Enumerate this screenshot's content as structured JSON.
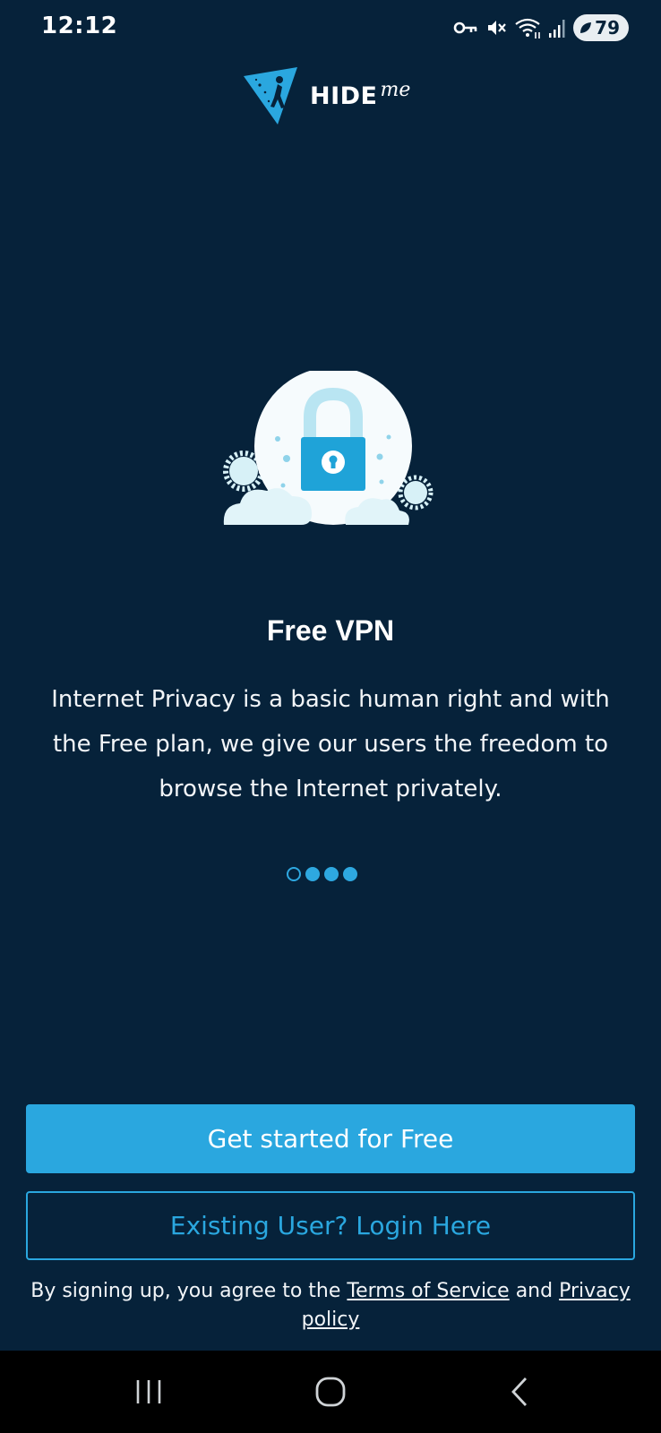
{
  "status_bar": {
    "time": "12:12",
    "battery_level": "79",
    "icons": [
      "vpn-key-icon",
      "mute-icon",
      "wifi-icon",
      "signal-icon",
      "battery-saver-icon"
    ]
  },
  "logo": {
    "brand_main": "HIDE",
    "brand_suffix": "me"
  },
  "onboarding": {
    "illustration": "padlock-cloud-illustration",
    "title": "Free VPN",
    "description": "Internet Privacy is a basic human right and with the Free plan, we give our users the freedom to browse the Internet privately.",
    "pager": {
      "total": 4,
      "active_index": 0
    }
  },
  "actions": {
    "primary_label": "Get started for Free",
    "secondary_label": "Existing User? Login Here"
  },
  "legal": {
    "prefix": "By signing up, you agree to the ",
    "terms_link": "Terms of Service",
    "conjunction": " and ",
    "privacy_link": "Privacy policy"
  },
  "nav_bar": {
    "icons": [
      "recent-apps-icon",
      "home-icon",
      "back-icon"
    ]
  },
  "colors": {
    "background": "#06223a",
    "accent": "#2aa7df",
    "text": "#ffffff"
  }
}
